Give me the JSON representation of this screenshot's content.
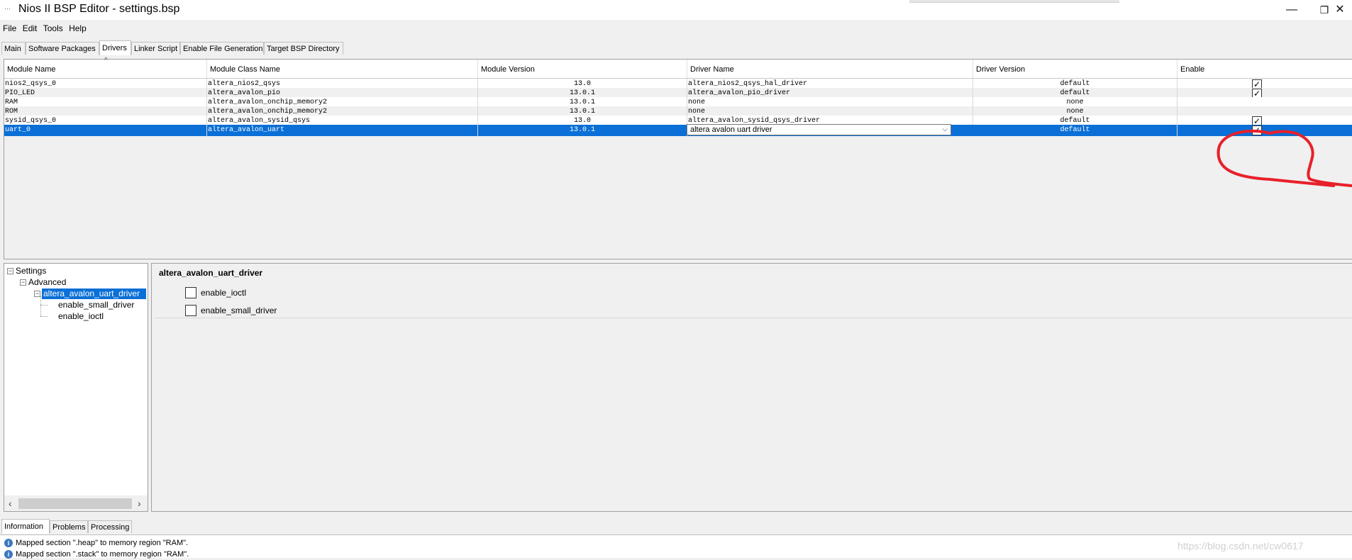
{
  "window": {
    "title": "Nios II BSP Editor - settings.bsp",
    "icon": "app-icon",
    "controls": {
      "minimize": "—",
      "restore": "❐",
      "close": "✕"
    }
  },
  "menu": [
    "File",
    "Edit",
    "Tools",
    "Help"
  ],
  "tabs": [
    "Main",
    "Software Packages",
    "Drivers",
    "Linker Script",
    "Enable File Generation",
    "Target BSP Directory"
  ],
  "active_tab": "Drivers",
  "table": {
    "columns": [
      "Module Name",
      "Module Class Name",
      "Module Version",
      "Driver Name",
      "Driver Version",
      "Enable"
    ],
    "sort_indicator": "^",
    "rows": [
      {
        "module": "nios2_qsys_0",
        "class": "altera_nios2_qsys",
        "version": "13.0",
        "driver": "altera_nios2_qsys_hal_driver",
        "driver_version": "default",
        "enabled": true
      },
      {
        "module": "PIO_LED",
        "class": "altera_avalon_pio",
        "version": "13.0.1",
        "driver": "altera_avalon_pio_driver",
        "driver_version": "default",
        "enabled": true
      },
      {
        "module": "RAM",
        "class": "altera_avalon_onchip_memory2",
        "version": "13.0.1",
        "driver": "none",
        "driver_version": "none",
        "enabled": false
      },
      {
        "module": "ROM",
        "class": "altera_avalon_onchip_memory2",
        "version": "13.0.1",
        "driver": "none",
        "driver_version": "none",
        "enabled": false
      },
      {
        "module": "sysid_qsys_0",
        "class": "altera_avalon_sysid_qsys",
        "version": "13.0",
        "driver": "altera_avalon_sysid_qsys_driver",
        "driver_version": "default",
        "enabled": true
      },
      {
        "module": "uart_0",
        "class": "altera_avalon_uart",
        "version": "13.0.1",
        "driver": "altera avalon uart driver",
        "driver_version": "default",
        "enabled": true,
        "selected": true
      }
    ],
    "selection_color": "#0a6fd6",
    "annotation_color": "#e8202a"
  },
  "tree": {
    "root": "Settings",
    "advanced": "Advanced",
    "driver": "altera_avalon_uart_driver",
    "children": [
      "enable_small_driver",
      "enable_ioctl"
    ]
  },
  "detail": {
    "title": "altera_avalon_uart_driver",
    "options": [
      {
        "label": "enable_ioctl",
        "checked": false
      },
      {
        "label": "enable_small_driver",
        "checked": false
      }
    ]
  },
  "bottom_tabs": [
    "Information",
    "Problems",
    "Processing"
  ],
  "messages": [
    "Mapped section \".heap\" to memory region \"RAM\".",
    "Mapped section \".stack\" to memory region \"RAM\"."
  ],
  "watermark": "https://blog.csdn.net/cw0617"
}
